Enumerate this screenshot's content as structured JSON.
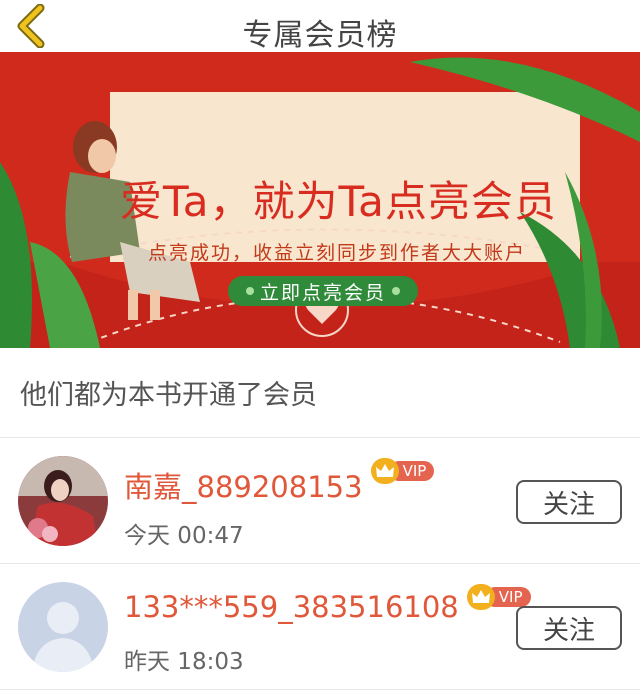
{
  "header": {
    "title": "专属会员榜"
  },
  "banner": {
    "headline": "爱Ta，就为Ta点亮会员",
    "subtitle": "点亮成功，收益立刻同步到作者大大账户",
    "cta_label": "立即点亮会员"
  },
  "section": {
    "title": "他们都为本书开通了会员"
  },
  "members": [
    {
      "name": "南嘉_889208153",
      "badge": "VIP",
      "time": "今天 00:47",
      "follow_label": "关注"
    },
    {
      "name": "133***559_383516108",
      "badge": "VIP",
      "time": "昨天 18:03",
      "follow_label": "关注"
    }
  ],
  "colors": {
    "accent": "#e0573a",
    "banner_red": "#cf2a1b",
    "cta_green": "#2f8a3a",
    "back_icon": "#f0c21d"
  }
}
